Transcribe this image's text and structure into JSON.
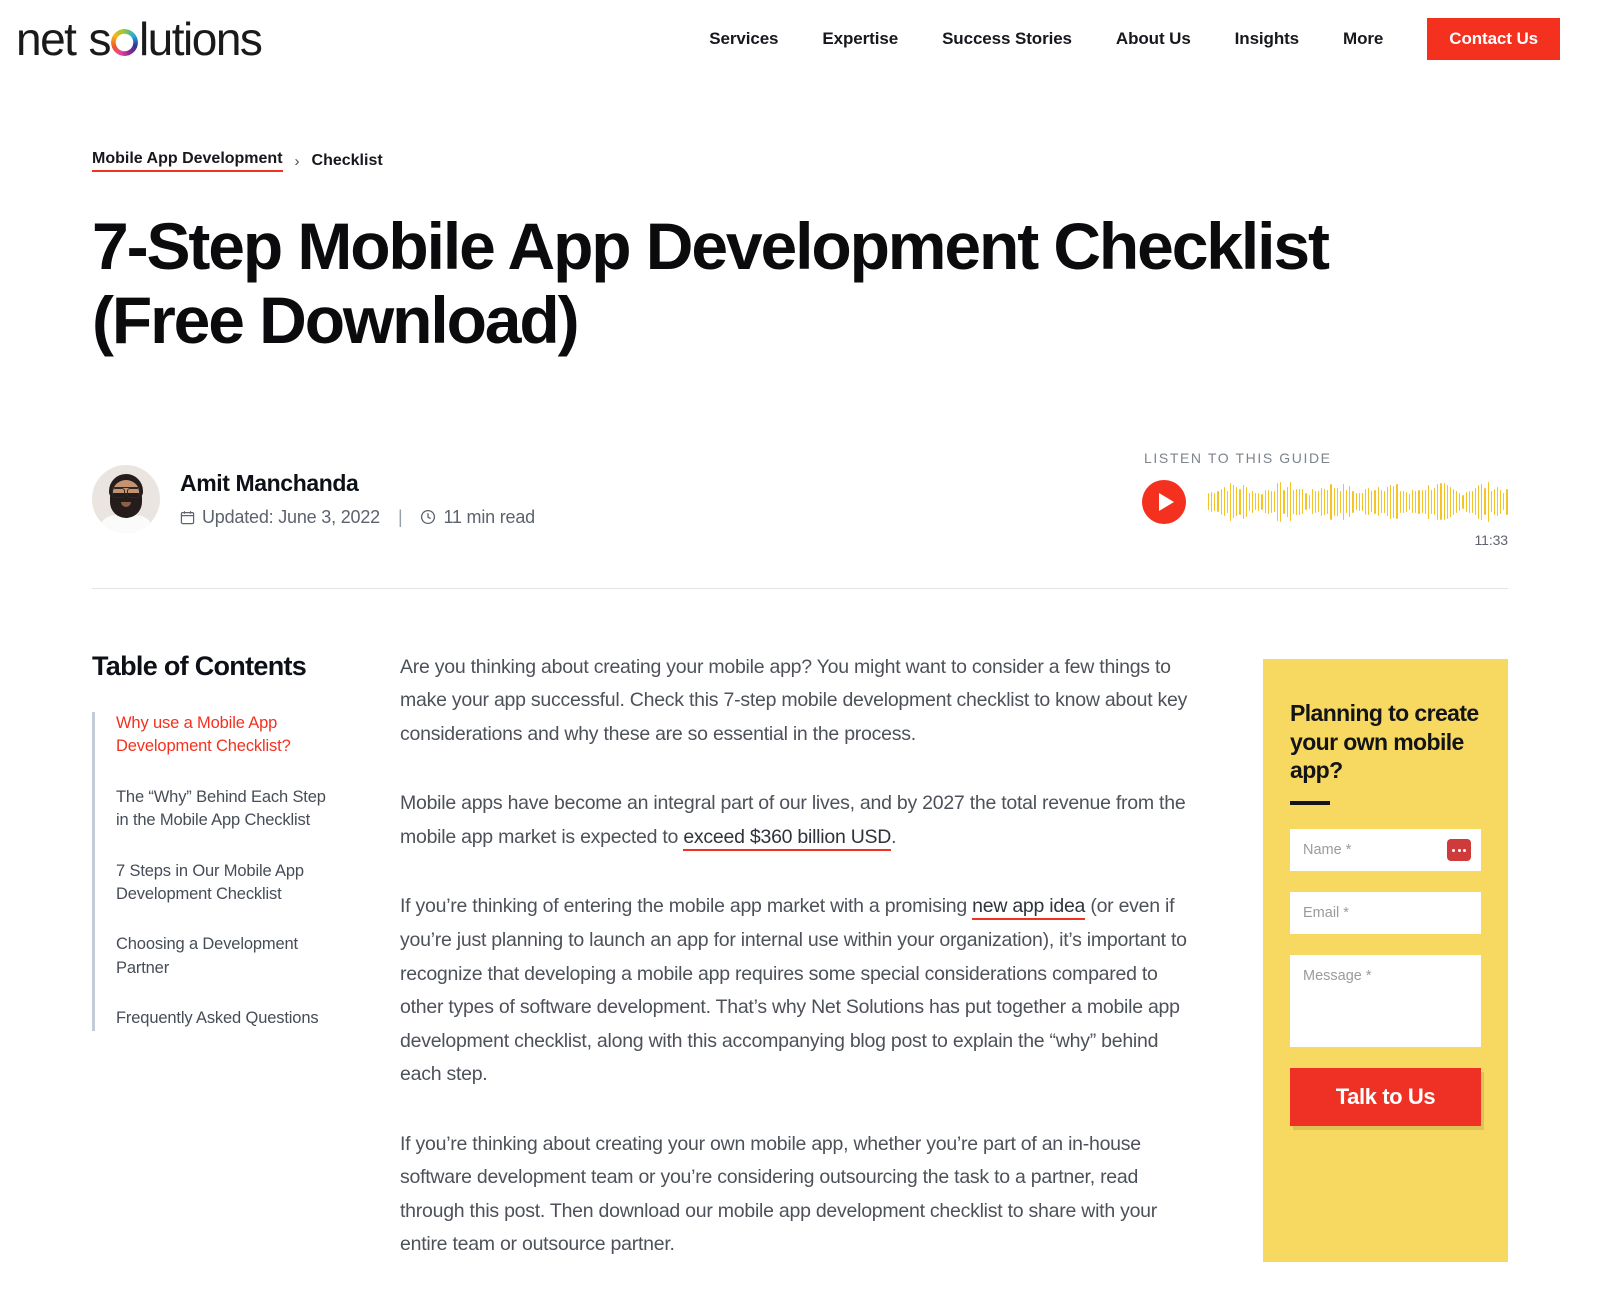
{
  "header": {
    "logo_text_1": "net",
    "logo_text_2": "s",
    "logo_text_3": "lutions",
    "nav_items": [
      {
        "label": "Services"
      },
      {
        "label": "Expertise"
      },
      {
        "label": "Success Stories"
      },
      {
        "label": "About Us"
      },
      {
        "label": "Insights"
      },
      {
        "label": "More"
      }
    ],
    "contact_label": "Contact Us"
  },
  "breadcrumb": {
    "link": "Mobile App Development",
    "separator": "›",
    "current": "Checklist"
  },
  "title": "7-Step Mobile App Development Checklist (Free Download)",
  "meta": {
    "author": "Amit Manchanda",
    "updated": "Updated: June 3, 2022",
    "divider": "|",
    "read_time": "11 min read",
    "calendar_icon": "calendar-icon",
    "clock_icon": "clock-icon"
  },
  "audio": {
    "label": "LISTEN TO THIS GUIDE",
    "play_icon": "play-icon",
    "duration": "11:33"
  },
  "toc": {
    "title": "Table of Contents",
    "items": [
      {
        "label": "Why use a Mobile App Development Checklist?",
        "active": true
      },
      {
        "label": "The “Why” Behind Each Step in the Mobile App Checklist",
        "active": false
      },
      {
        "label": "7 Steps in Our Mobile App Development Checklist",
        "active": false
      },
      {
        "label": "Choosing a Development Partner",
        "active": false
      },
      {
        "label": "Frequently Asked Questions",
        "active": false
      }
    ]
  },
  "article": {
    "p1": "Are you thinking about creating your mobile app? You might want to consider a few things to make your app successful. Check this 7-step mobile development checklist to know about key considerations and why these are so essential in the process.",
    "p2_before": "Mobile apps have become an integral part of our lives, and by 2027 the total revenue from the mobile app market is expected to ",
    "p2_link": "exceed $360 billion USD",
    "p2_after": ".",
    "p3_before": "If you’re thinking of entering the mobile app market with a promising ",
    "p3_link": "new app idea",
    "p3_after": " (or even if you’re just planning to launch an app for internal use within your organization), it’s important to recognize that developing a mobile app requires some special considerations compared to other types of software development. That’s why Net Solutions has put together a mobile app development checklist, along with this accompanying blog post to explain the “why” behind each step.",
    "p4": "If you’re thinking about creating your own mobile app, whether you’re part of an in-house software development team or you’re considering outsourcing the task to a partner, read through this post. Then download our mobile app development checklist to share with your entire team or outsource partner."
  },
  "form": {
    "heading": "Planning to create your own mobile app?",
    "name_placeholder": "Name *",
    "email_placeholder": "Email *",
    "message_placeholder": "Message *",
    "submit_label": "Talk to Us",
    "autofill_icon": "autofill-icon"
  },
  "colors": {
    "accent_red": "#f4311f",
    "form_yellow": "#f7d860",
    "waveform_yellow": "#f6c324",
    "body_text": "#4d5159"
  }
}
